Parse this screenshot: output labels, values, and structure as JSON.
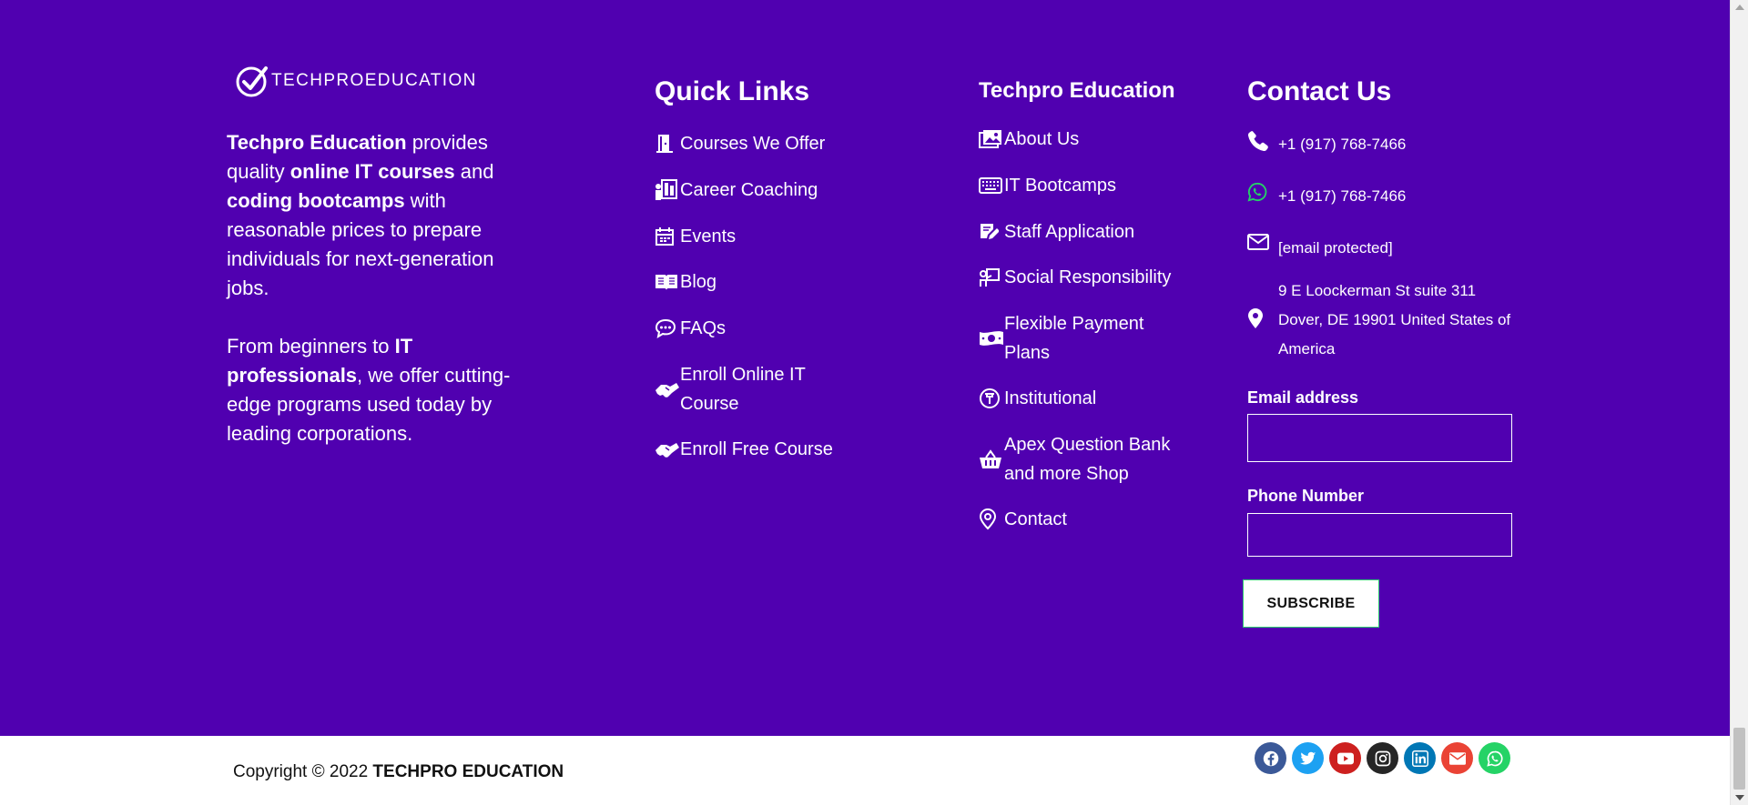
{
  "logo": {
    "text": "TECHPROEDUCATION"
  },
  "about": {
    "p1": [
      {
        "text": "Techpro Education",
        "bold": true
      },
      {
        "text": " provides quality ",
        "bold": false
      },
      {
        "text": "online IT courses",
        "bold": true
      },
      {
        "text": " and ",
        "bold": false
      },
      {
        "text": "coding bootcamps",
        "bold": true
      },
      {
        "text": "  with reasonable prices to prepare individuals for next-generation jobs.",
        "bold": false
      }
    ],
    "p2": [
      {
        "text": "From beginners to ",
        "bold": false
      },
      {
        "text": "IT professionals",
        "bold": true
      },
      {
        "text": ", we offer cutting-edge programs used today by leading corporations.",
        "bold": false
      }
    ]
  },
  "quick_links": {
    "heading": "Quick Links",
    "items": [
      {
        "label": "Courses We Offer",
        "icon": "door-icon"
      },
      {
        "label": "Career Coaching",
        "icon": "people-board-icon"
      },
      {
        "label": "Events",
        "icon": "calendar-icon"
      },
      {
        "label": "Blog",
        "icon": "book-open-icon"
      },
      {
        "label": "FAQs",
        "icon": "chat-bubble-icon"
      },
      {
        "label": "Enroll Online IT Course",
        "icon": "handshake-icon"
      },
      {
        "label": "Enroll Free Course",
        "icon": "handshake-icon"
      }
    ]
  },
  "techpro_links": {
    "heading": "Techpro Education",
    "items": [
      {
        "label": "About Us",
        "icon": "photo-icon"
      },
      {
        "label": "IT Bootcamps",
        "icon": "keyboard-icon"
      },
      {
        "label": "Staff Application",
        "icon": "edit-form-icon"
      },
      {
        "label": "Social Responsibility",
        "icon": "presenter-icon"
      },
      {
        "label": "Flexible Payment Plans",
        "icon": "money-bill-icon"
      },
      {
        "label": "Institutional",
        "icon": "tiktok-like-icon"
      },
      {
        "label": "Apex Question Bank and more Shop",
        "icon": "basket-icon"
      },
      {
        "label": "Contact",
        "icon": "map-pin-outline-icon"
      }
    ]
  },
  "contact": {
    "heading": "Contact Us",
    "phone": "+1 (917) 768-7466",
    "whatsapp": "+1 (917) 768-7466",
    "email": "[email protected]",
    "address": "9 E Loockerman St suite 311 Dover, DE 19901 United States of America"
  },
  "form": {
    "email_label": "Email address",
    "phone_label": "Phone Number",
    "submit_label": "SUBSCRIBE"
  },
  "footer_bottom": {
    "copyright_prefix": "Copyright © 2022 ",
    "copyright_brand": "TECHPRO EDUCATION"
  },
  "socials": [
    {
      "name": "facebook-icon",
      "color": "#3b5998"
    },
    {
      "name": "twitter-icon",
      "color": "#1da1f2"
    },
    {
      "name": "youtube-icon",
      "color": "#cd201f"
    },
    {
      "name": "instagram-icon",
      "color": "#262626"
    },
    {
      "name": "linkedin-icon",
      "color": "#0077b5"
    },
    {
      "name": "envelope-icon",
      "color": "#ea4335"
    },
    {
      "name": "whatsapp-icon",
      "color": "#25d366"
    }
  ],
  "colors": {
    "footer_bg": "#5000b0",
    "text": "#ffffff",
    "whatsapp_green": "#25d366"
  }
}
